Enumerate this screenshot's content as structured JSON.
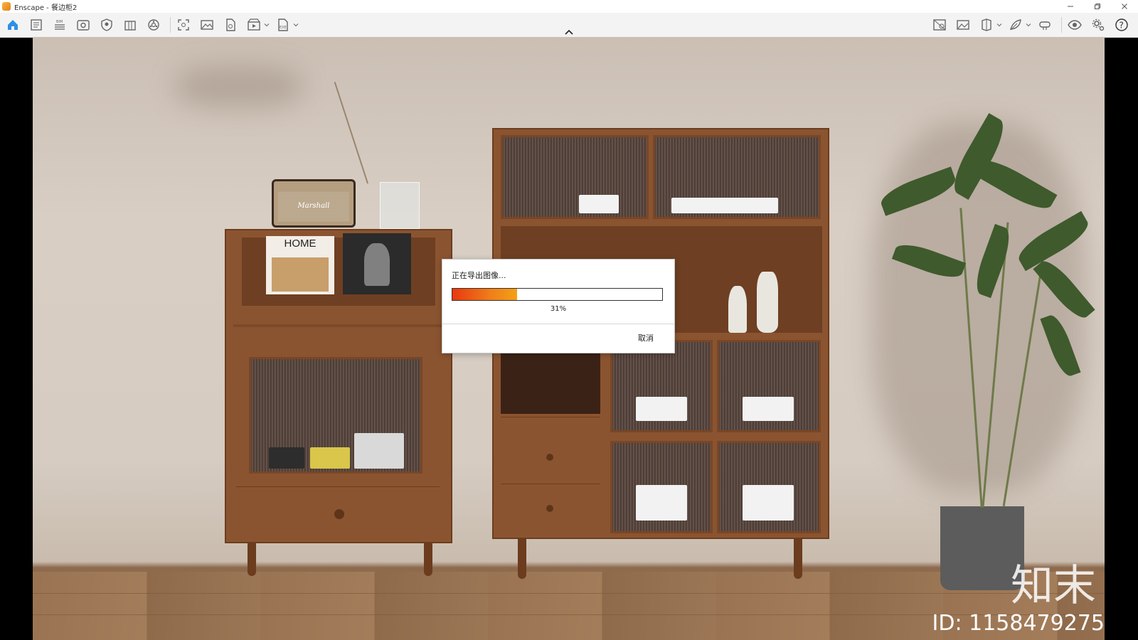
{
  "window": {
    "title": "Enscape - 餐边柜2",
    "controls": [
      "minimize-icon",
      "restore-icon",
      "close-icon"
    ]
  },
  "toolbar": {
    "left_icons": [
      "home-icon",
      "views-icon",
      "bim-icon",
      "visual-settings-icon",
      "asset-library-icon",
      "material-editor-icon",
      "panorama-icon",
      "screenshot-icon",
      "image-export-icon",
      "batch-render-icon",
      "video-export-icon",
      "exe-export-icon"
    ],
    "right_icons": [
      "collaborative-annotation-icon",
      "image-gallery-icon",
      "section-view-icon",
      "feedback-icon",
      "vr-headset-icon",
      "visibility-icon",
      "settings-icon",
      "help-icon"
    ],
    "bim_badge": "BIM",
    "exe_badge": "EXE",
    "help_symbol": "?"
  },
  "viewport": {
    "watermark": "知末",
    "watermark_id": "ID: 1158479275",
    "magazine_title": "HOME",
    "radio_brand": "Marshall"
  },
  "dialog": {
    "title": "正在导出图像...",
    "progress_percent": 31,
    "progress_label": "31%",
    "cancel_label": "取消"
  }
}
